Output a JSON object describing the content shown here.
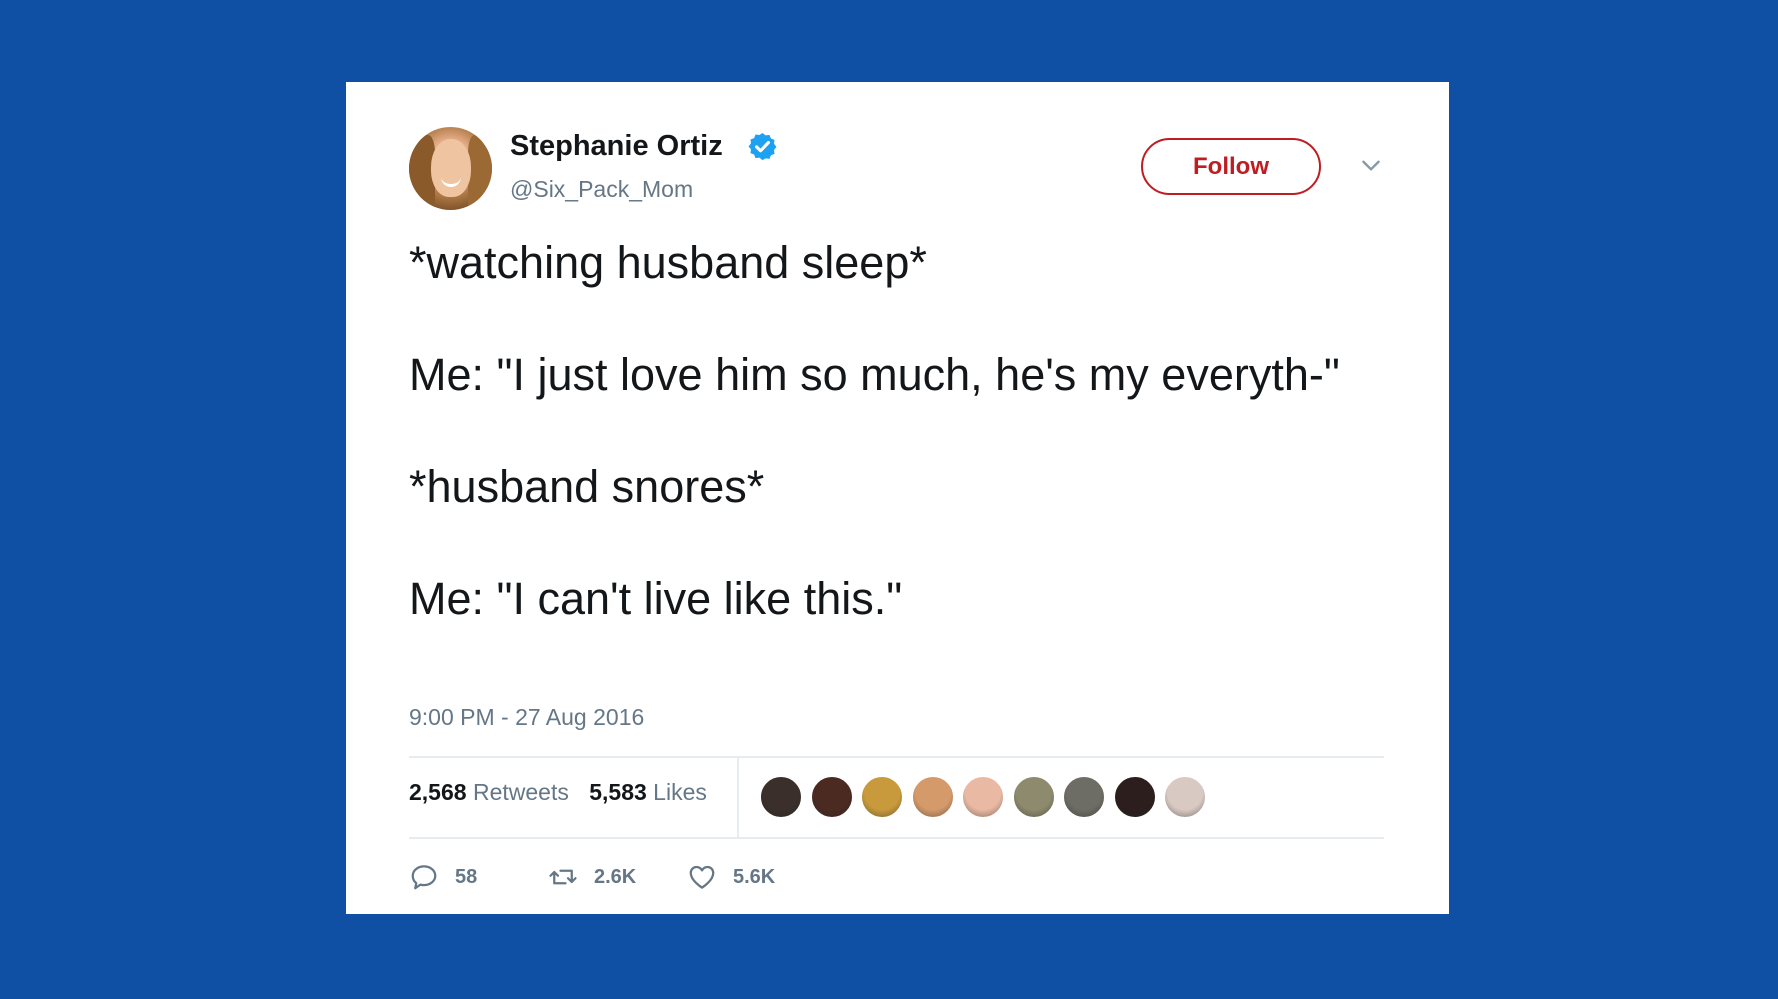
{
  "tweet": {
    "author": {
      "display_name": "Stephanie Ortiz",
      "handle": "@Six_Pack_Mom",
      "verified": true
    },
    "follow_label": "Follow",
    "text_lines": [
      "*watching husband sleep*",
      "Me: \"I just love him so much, he's my everyth-\"",
      "*husband snores*",
      "Me: \"I can't live like this.\""
    ],
    "timestamp": "9:00 PM - 27 Aug 2016",
    "stats": {
      "retweets_count": "2,568",
      "retweets_label": "Retweets",
      "likes_count": "5,583",
      "likes_label": "Likes"
    },
    "likers": [
      {
        "name": "liker-avatar",
        "color": "#3a2f2a"
      },
      {
        "name": "liker-avatar",
        "color": "#4b2a22"
      },
      {
        "name": "liker-avatar",
        "color": "#c89a3c"
      },
      {
        "name": "liker-avatar",
        "color": "#d59a6a"
      },
      {
        "name": "liker-avatar",
        "color": "#e9b9a3"
      },
      {
        "name": "liker-avatar",
        "color": "#8e8a6e"
      },
      {
        "name": "liker-avatar",
        "color": "#6d6d65"
      },
      {
        "name": "liker-avatar",
        "color": "#2b1e1c"
      },
      {
        "name": "liker-avatar",
        "color": "#d9c9c3"
      }
    ],
    "actions": {
      "reply_count": "58",
      "retweet_count": "2.6K",
      "like_count": "5.6K"
    }
  },
  "colors": {
    "background": "#0f50a5",
    "card": "#ffffff",
    "follow_accent": "#c01d22",
    "verified_blue": "#1da1f2",
    "muted_text": "#657786"
  }
}
